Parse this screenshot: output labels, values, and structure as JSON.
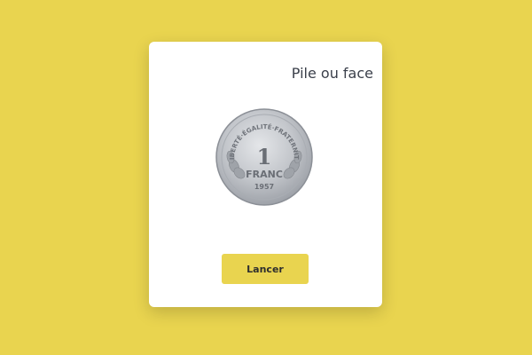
{
  "game": {
    "title": "Pile ou face",
    "launch_button_label": "Lancer"
  },
  "coin": {
    "icon": "coin-icon",
    "legend_top": "LIBERTÉ·ÉGALITÉ·FRATERNITÉ",
    "value": "1",
    "unit": "FRANC",
    "year": "1957"
  },
  "colors": {
    "background": "#e9d44f",
    "card": "#ffffff",
    "button": "#e9d44f",
    "title_text": "#3a3f4a"
  }
}
